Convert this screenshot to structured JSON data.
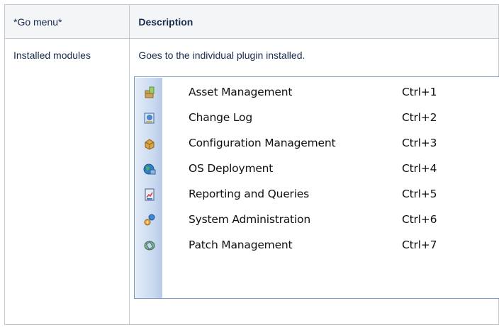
{
  "table": {
    "header": {
      "col1": "*Go menu*",
      "col2": "Description"
    },
    "row": {
      "col1": "Installed modules",
      "col2": "Goes to the individual plugin installed."
    }
  },
  "menu": {
    "items": [
      {
        "label": "Asset Management",
        "shortcut": "Ctrl+1",
        "icon": "asset-management-icon"
      },
      {
        "label": "Change Log",
        "shortcut": "Ctrl+2",
        "icon": "change-log-icon"
      },
      {
        "label": "Configuration Management",
        "shortcut": "Ctrl+3",
        "icon": "configuration-management-icon"
      },
      {
        "label": "OS Deployment",
        "shortcut": "Ctrl+4",
        "icon": "os-deployment-icon"
      },
      {
        "label": "Reporting and Queries",
        "shortcut": "Ctrl+5",
        "icon": "reporting-queries-icon"
      },
      {
        "label": "System Administration",
        "shortcut": "Ctrl+6",
        "icon": "system-administration-icon"
      },
      {
        "label": "Patch Management",
        "shortcut": "Ctrl+7",
        "icon": "patch-management-icon"
      }
    ]
  }
}
